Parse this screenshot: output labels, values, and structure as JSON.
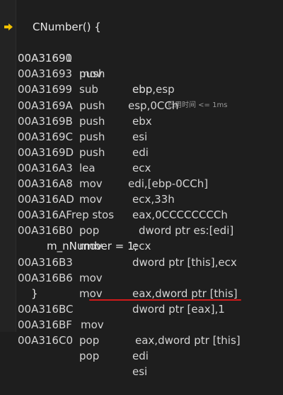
{
  "source": {
    "func_header": "CNumber() {",
    "statement": "m_nNumber = 1;",
    "closing_brace": "}"
  },
  "timing_hint": "已用时间 <= 1ms",
  "colors": {
    "background": "#1e1e1e",
    "text": "#d4d4d4",
    "arrow": "#f0c000",
    "underline": "#d11a1a"
  },
  "instructions": [
    {
      "addr": "00A31690",
      "op": "push",
      "args": "ebp"
    },
    {
      "addr": "00A31691",
      "op": "mov",
      "args": "ebp,esp"
    },
    {
      "addr": "00A31693",
      "op": "sub",
      "args": "esp,0CCh"
    },
    {
      "addr": "00A31699",
      "op": "push",
      "args": "ebx"
    },
    {
      "addr": "00A3169A",
      "op": "push",
      "args": "esi"
    },
    {
      "addr": "00A3169B",
      "op": "push",
      "args": "edi"
    },
    {
      "addr": "00A3169C",
      "op": "push",
      "args": "ecx"
    },
    {
      "addr": "00A3169D",
      "op": "lea",
      "args": "edi,[ebp-0CCh]"
    },
    {
      "addr": "00A316A3",
      "op": "mov",
      "args": "ecx,33h"
    },
    {
      "addr": "00A316A8",
      "op": "mov",
      "args": "eax,0CCCCCCCCh"
    },
    {
      "addr": "00A316AD",
      "op": "rep stos",
      "args": "dword ptr es:[edi]"
    },
    {
      "addr": "00A316AF",
      "op": "pop",
      "args": "ecx"
    },
    {
      "addr": "00A316B0",
      "op": "mov",
      "args": "dword ptr [this],ecx"
    },
    {
      "addr": "00A316B3",
      "op": "mov",
      "args": "eax,dword ptr [this]"
    },
    {
      "addr": "00A316B6",
      "op": "mov",
      "args": "dword ptr [eax],1"
    },
    {
      "addr": "00A316BC",
      "op": "mov",
      "args": "eax,dword ptr [this]"
    },
    {
      "addr": "00A316BF",
      "op": "pop",
      "args": "edi"
    },
    {
      "addr": "00A316C0",
      "op": "pop",
      "args": "esi"
    }
  ]
}
